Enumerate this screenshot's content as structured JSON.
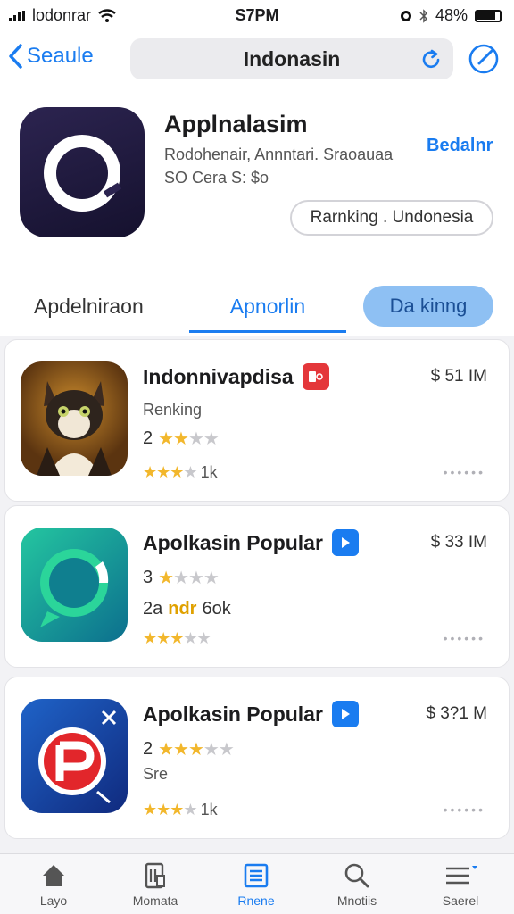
{
  "status_bar": {
    "carrier": "lodonrar",
    "time": "S7PM",
    "battery": "48%"
  },
  "nav": {
    "back_label": "Seaule",
    "title": "Indonasin"
  },
  "app": {
    "name": "Applnalasim",
    "subtitle_1": "Rodohenair, Annntari. Sraoauaa",
    "subtitle_2": "SO Cera S: $o",
    "action_label": "Bedalnr",
    "chip_label": "Rarnking . Undonesia"
  },
  "tabs": [
    {
      "label": "Apdelniraon"
    },
    {
      "label": "Apnorlin"
    },
    {
      "label": "Da kinng"
    }
  ],
  "list": [
    {
      "title": "Indonnivapdisa",
      "price": "$ 51 IM",
      "line2": "Renking",
      "rating_number": "2",
      "stars": 2,
      "line4": "1k",
      "stars_small": 2.5,
      "badge_color": "#e4373a"
    },
    {
      "title": "Apolkasin Popular",
      "price": "$ 33 IM",
      "line2": "3",
      "rating_number": "2a",
      "rating_highlight": "ndr",
      "rating_suffix": "6ok",
      "stars": 1,
      "line4": "",
      "stars_small": 3,
      "badge_color": "#1a7cf0"
    },
    {
      "title": "Apolkasin Popular",
      "price": "$ 3?1 M",
      "line2": "2",
      "rating_number": "Sre",
      "stars": 3.5,
      "line4": "1k",
      "stars_small": 2.5,
      "badge_color": "#1a7cf0"
    }
  ],
  "tabbar": [
    {
      "label": "Layo",
      "icon": "home-icon"
    },
    {
      "label": "Momata",
      "icon": "documents-icon"
    },
    {
      "label": "Rnene",
      "icon": "list-icon"
    },
    {
      "label": "Mnotiis",
      "icon": "search-icon"
    },
    {
      "label": "Saerel",
      "icon": "menu-icon"
    }
  ],
  "colors": {
    "accent": "#1a7cf0",
    "star": "#f2b72c"
  }
}
